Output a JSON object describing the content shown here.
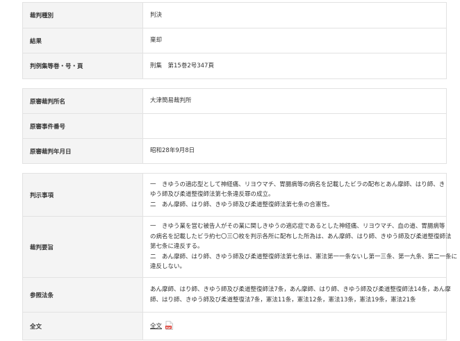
{
  "table1": {
    "rows": [
      {
        "label": "裁判種別",
        "value": "判決"
      },
      {
        "label": "結果",
        "value": "棄却"
      },
      {
        "label": "判例集等巻・号・頁",
        "value": "刑集　第15巻2号347頁"
      }
    ]
  },
  "table2": {
    "rows": [
      {
        "label": "原審裁判所名",
        "value": "大津簡易裁判所"
      },
      {
        "label": "原審事件番号",
        "value": ""
      },
      {
        "label": "原審裁判年月日",
        "value": "昭和28年9月8日"
      }
    ]
  },
  "table3": {
    "hanji": {
      "label": "判示事項",
      "lines": [
        "一　きゆうの適応型として神経痛、リヨウマチ、胃腸病等の病名を記載したビラの配布とあん摩師、はり師、き",
        "ゆう師及び柔道整復師法第七条違反罪の成立。",
        "二　あん摩師、はり師、きゆう師及び柔道整復師法第七条の合憲性。"
      ]
    },
    "yoshi": {
      "label": "裁判要旨",
      "lines": [
        "一　きゆう業を営む被告人がその業に関しきゆうの適応症であるとした神経痛、リヨウマチ、血の道、胃腸病等",
        "の病名を記載したビラ約七〇三〇枚を判示各所に配布した所為は、あん摩師、はり師、きゆう師及び柔道整復師法",
        "第七条に違反する。",
        "二　あん摩師、はり師、きゆう師及び柔道整復師法第七条は、憲法第一一条ないし第一三条、第一九条、第二一条に",
        "違反しない。"
      ]
    },
    "sansho": {
      "label": "参照法条",
      "lines": [
        "あん摩師、はり師、きゆう師及び柔道整復師法7条，あん摩師、はり師、きゆう師及び柔道整復師法14条，あん摩",
        "師、はり師、きゆう師及び柔道整復法7条，憲法11条，憲法12条，憲法13条，憲法19条，憲法21条"
      ]
    },
    "zenbun": {
      "label": "全文",
      "link": "全文",
      "icon": "pdf-icon",
      "icon_text": "PDF",
      "icon_color": "#d9342b"
    }
  }
}
